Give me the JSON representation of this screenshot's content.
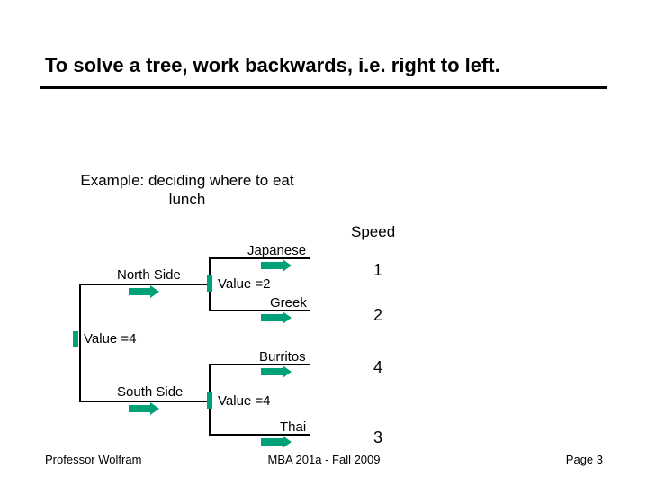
{
  "title": "To solve a tree, work backwards, i.e. right to left.",
  "example": "Example: deciding where to eat lunch",
  "columns": {
    "speed": "Speed"
  },
  "tree": {
    "root": {
      "value_label": "Value =4",
      "children": [
        {
          "label": "North Side",
          "value_label": "Value =2",
          "children": [
            {
              "label": "Japanese",
              "value": "1"
            },
            {
              "label": "Greek",
              "value": "2"
            }
          ]
        },
        {
          "label": "South Side",
          "value_label": "Value =4",
          "children": [
            {
              "label": "Burritos",
              "value": "4"
            },
            {
              "label": "Thai",
              "value": "3"
            }
          ]
        }
      ]
    }
  },
  "footer": {
    "left": "Professor Wolfram",
    "center": "MBA 201a - Fall 2009",
    "right": "Page 3"
  }
}
